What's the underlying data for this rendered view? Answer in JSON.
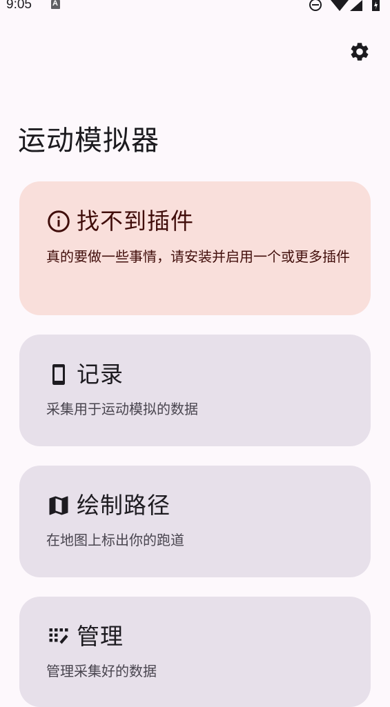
{
  "status_bar": {
    "time": "9:05",
    "notification_icon": "a-icon",
    "right_icons": [
      "do-not-disturb-icon",
      "wifi-icon",
      "signal-icon",
      "battery-charging-icon"
    ]
  },
  "toolbar": {
    "settings_icon": "gear-icon"
  },
  "page": {
    "title": "运动模拟器"
  },
  "cards": {
    "warning": {
      "icon": "info-icon",
      "title": "找不到插件",
      "description": "真的要做一些事情，请安装并启用一个或更多插件"
    },
    "record": {
      "icon": "phone-icon",
      "title": "记录",
      "description": "采集用于运动模拟的数据"
    },
    "route": {
      "icon": "map-icon",
      "title": "绘制路径",
      "description": "在地图上标出你的跑道"
    },
    "manage": {
      "icon": "manage-icon",
      "title": "管理",
      "description": "管理采集好的数据"
    }
  },
  "colors": {
    "background": "#fdf8fc",
    "warning_card": "#f9dfdb",
    "warning_text": "#410e0b",
    "card": "#e7e0ea",
    "card_text": "#1d1b20",
    "card_secondary_text": "#49454f"
  }
}
